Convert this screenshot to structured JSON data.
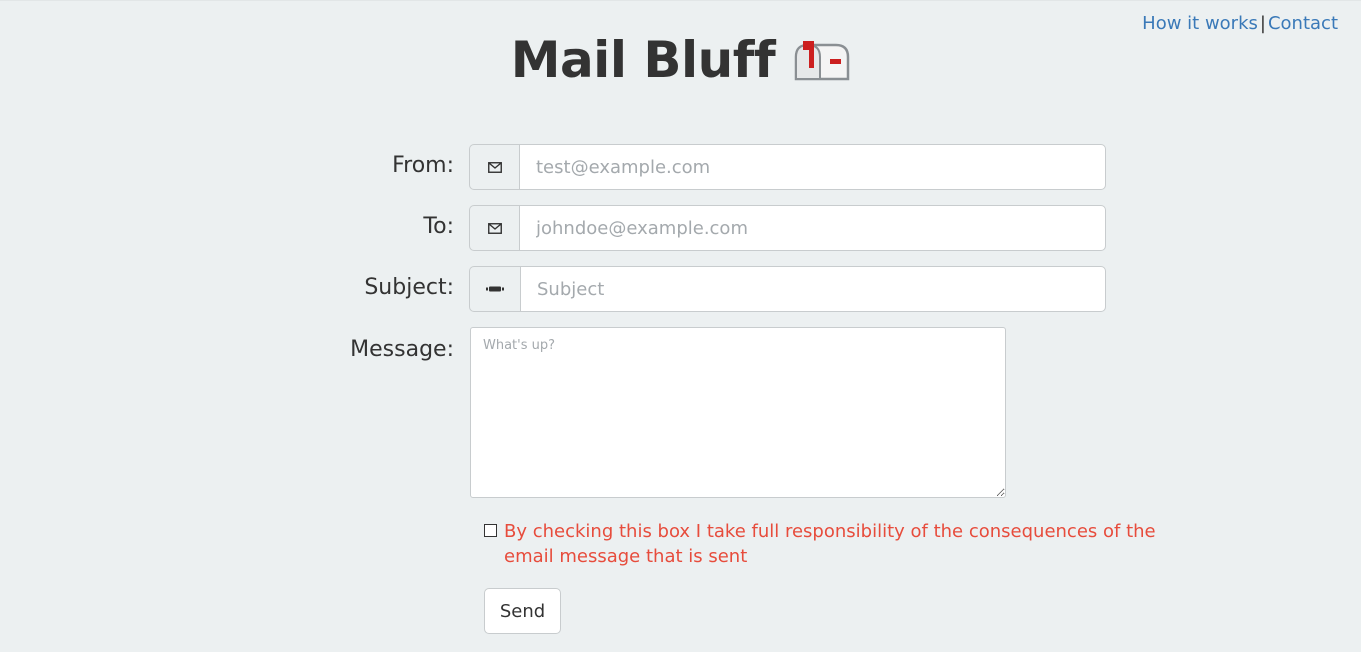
{
  "nav": {
    "how_it_works": "How it works",
    "separator": "|",
    "contact": "Contact"
  },
  "header": {
    "title": "Mail Bluff",
    "logo_icon": "mailbox-icon"
  },
  "form": {
    "from": {
      "label": "From:",
      "placeholder": "test@example.com",
      "icon": "envelope-icon"
    },
    "to": {
      "label": "To:",
      "placeholder": "johndoe@example.com",
      "icon": "envelope-icon"
    },
    "subject": {
      "label": "Subject:",
      "placeholder": "Subject",
      "icon": "minus-icon"
    },
    "message": {
      "label": "Message:",
      "placeholder": "What's up?"
    },
    "consent": {
      "text": "By checking this box I take full responsibility of the consequences of the email message that is sent",
      "checked": false
    },
    "send_label": "Send"
  },
  "colors": {
    "background": "#ecf0f1",
    "link": "#3a79b8",
    "warning": "#e74c3c",
    "mailbox_flag": "#cc1f1f"
  }
}
